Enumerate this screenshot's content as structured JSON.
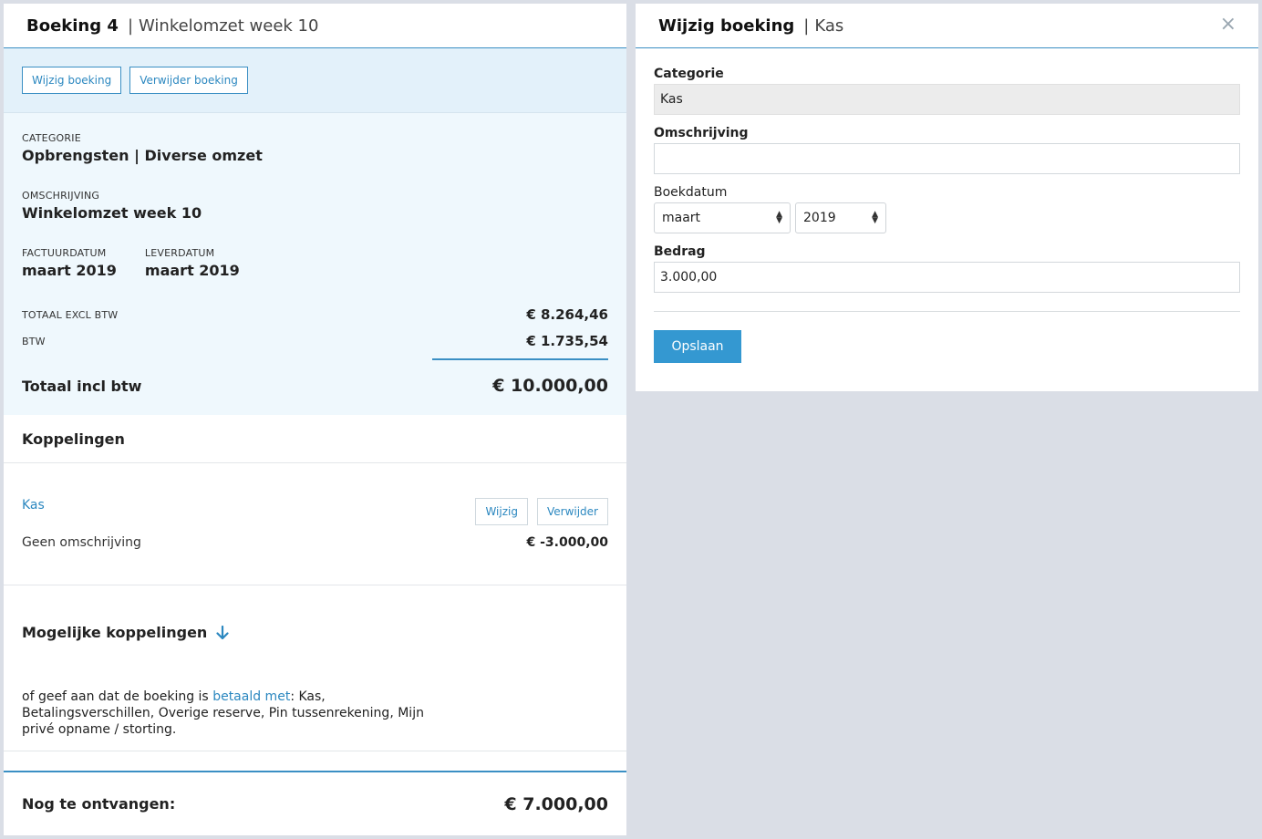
{
  "left": {
    "header": {
      "title": "Boeking 4",
      "separator": "|",
      "subtitle": "Winkelomzet week 10"
    },
    "actions": {
      "edit_label": "Wijzig boeking",
      "delete_label": "Verwijder boeking"
    },
    "details": {
      "categorie_label": "CATEGORIE",
      "categorie_value": "Opbrengsten | Diverse omzet",
      "omschrijving_label": "OMSCHRIJVING",
      "omschrijving_value": "Winkelomzet week 10",
      "factuurdatum_label": "FACTUURDATUM",
      "factuurdatum_value": "maart 2019",
      "leverdatum_label": "LEVERDATUM",
      "leverdatum_value": "maart 2019",
      "totaal_excl_label": "TOTAAL EXCL BTW",
      "totaal_excl_value": "€ 8.264,46",
      "btw_label": "BTW",
      "btw_value": "€ 1.735,54",
      "totaal_incl_label": "Totaal incl btw",
      "totaal_incl_value": "€ 10.000,00"
    },
    "koppelingen": {
      "title": "Koppelingen",
      "item": {
        "name": "Kas",
        "edit_label": "Wijzig",
        "delete_label": "Verwijder",
        "description": "Geen omschrijving",
        "amount": "€ -3.000,00"
      }
    },
    "mogelijke": {
      "title": "Mogelijke koppelingen",
      "text_before": "of geef aan dat de boeking is ",
      "link_text": "betaald met",
      "text_after": ": Kas, Betalingsverschillen, Overige reserve, Pin tussenrekening, Mijn privé opname / storting."
    },
    "nog": {
      "label": "Nog te ontvangen:",
      "amount": "€ 7.000,00"
    }
  },
  "right": {
    "header": {
      "title": "Wijzig boeking",
      "separator": "|",
      "subtitle": "Kas",
      "close": "×"
    },
    "form": {
      "categorie_label": "Categorie",
      "categorie_value": "Kas",
      "omschrijving_label": "Omschrijving",
      "omschrijving_value": "",
      "boekdatum_label": "Boekdatum",
      "month_value": "maart",
      "year_value": "2019",
      "bedrag_label": "Bedrag",
      "bedrag_value": "3.000,00",
      "save_label": "Opslaan"
    }
  },
  "colors": {
    "accent": "#3a8fc4",
    "primary_button": "#3498d1",
    "link": "#2c88c0",
    "details_bg": "#eff8fd",
    "page_bg": "#dadee6"
  }
}
